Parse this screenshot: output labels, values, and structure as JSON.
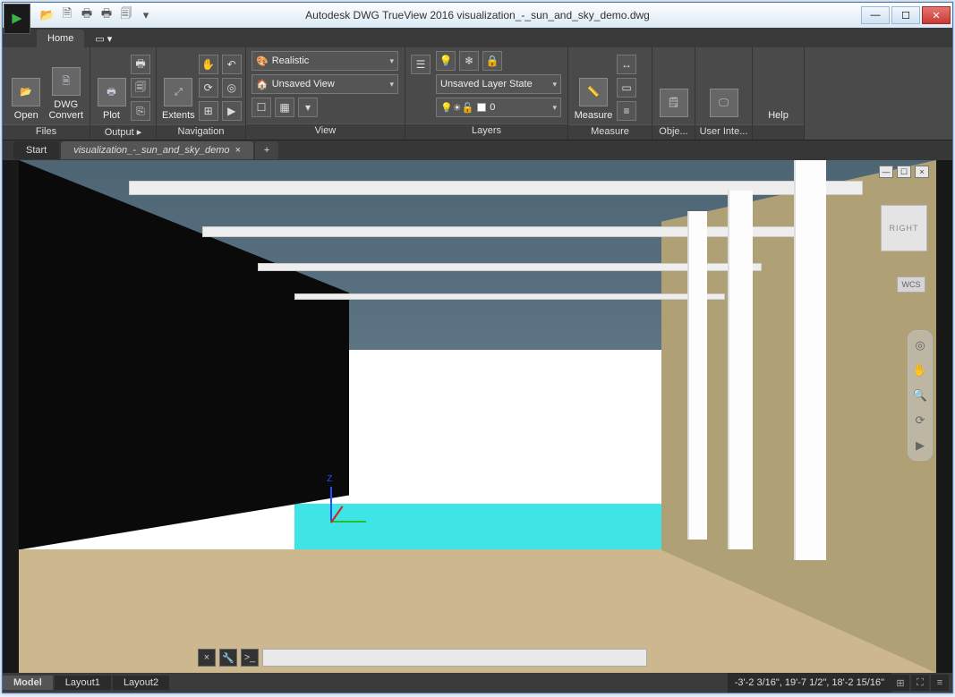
{
  "titlebar": {
    "app_title": "Autodesk DWG TrueView 2016     visualization_-_sun_and_sky_demo.dwg"
  },
  "tabs": {
    "home": "Home"
  },
  "ribbon": {
    "files": {
      "title": "Files",
      "open": "Open",
      "dwg_convert": "DWG\nConvert"
    },
    "output": {
      "title": "Output  ▸",
      "plot": "Plot"
    },
    "navigation": {
      "title": "Navigation",
      "extents": "Extents"
    },
    "view": {
      "title": "View",
      "visual_style": "Realistic",
      "named_view": "Unsaved View"
    },
    "layers": {
      "title": "Layers",
      "state": "Unsaved Layer State",
      "current": "0"
    },
    "measure": {
      "title": "Measure",
      "measure": "Measure"
    },
    "objprops": {
      "title": "Obje..."
    },
    "ui": {
      "title": "User Inte..."
    },
    "help": {
      "title": "Help"
    }
  },
  "filetabs": {
    "start": "Start",
    "active": "visualization_-_sun_and_sky_demo",
    "add": "+"
  },
  "viewport": {
    "viewcube_face": "RIGHT",
    "wcs": "WCS",
    "axis_z": "Z"
  },
  "footer": {
    "model": "Model",
    "layout1": "Layout1",
    "layout2": "Layout2",
    "coords": "-3'-2 3/16\", 19'-7 1/2\", 18'-2 15/16\""
  }
}
